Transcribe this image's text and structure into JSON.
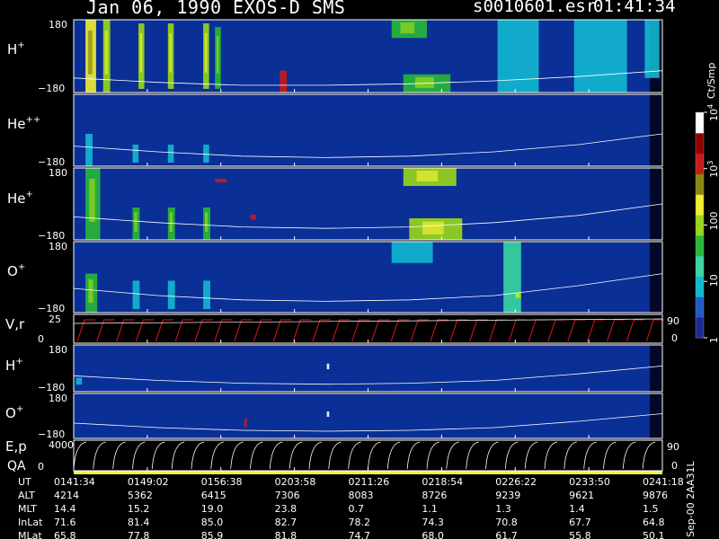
{
  "header": {
    "title": "Jan 06, 1990   EXOS-D SMS",
    "file": "s0010601.esr",
    "time": "01:41:34"
  },
  "colors": {
    "background": "#000000",
    "panel_fill": "#0a2f96",
    "axis": "#ffffff",
    "vr_trace": "#dd1a1a",
    "qa_bar": "#f0f050",
    "scale": [
      "#1c2a92",
      "#1e5ac8",
      "#12b8d0",
      "#38d8a0",
      "#28b838",
      "#98d818",
      "#f0f030",
      "#888810",
      "#c81a1a",
      "#900000",
      "#ffffff"
    ]
  },
  "colorbar": {
    "units": "Ct/Smp",
    "ticks": [
      {
        "label": "1",
        "value": 1
      },
      {
        "label": "10",
        "value": 10
      },
      {
        "label": "100",
        "value": 100
      },
      {
        "label": "10",
        "sup": "3",
        "value": 1000
      },
      {
        "label": "10",
        "sup": "4",
        "value": 10000
      }
    ]
  },
  "chart_data": {
    "type": "heatmap",
    "time_axis": [
      "0141:34",
      "0149:02",
      "0156:38",
      "0203:58",
      "0211:26",
      "0218:54",
      "0226:22",
      "0233:50",
      "0241:18"
    ],
    "panels": [
      {
        "id": "hplus-1",
        "label": "H",
        "sup": "+",
        "ylim": [
          -180,
          180
        ],
        "ticks": [
          "180",
          "−180"
        ],
        "blobs": [
          {
            "t": 0.02,
            "w": 0.018,
            "y0": 0.0,
            "y1": 1.0,
            "lvl": 6
          },
          {
            "t": 0.05,
            "w": 0.012,
            "y0": 0.0,
            "y1": 1.0,
            "lvl": 5
          },
          {
            "t": 0.11,
            "w": 0.01,
            "y0": 0.05,
            "y1": 0.95,
            "lvl": 5
          },
          {
            "t": 0.16,
            "w": 0.01,
            "y0": 0.05,
            "y1": 0.95,
            "lvl": 5
          },
          {
            "t": 0.22,
            "w": 0.01,
            "y0": 0.05,
            "y1": 0.95,
            "lvl": 5
          },
          {
            "t": 0.24,
            "w": 0.01,
            "y0": 0.1,
            "y1": 0.95,
            "lvl": 4
          },
          {
            "t": 0.35,
            "w": 0.012,
            "y0": 0.7,
            "y1": 1.0,
            "lvl": 8
          },
          {
            "t": 0.54,
            "w": 0.06,
            "y0": 0.0,
            "y1": 0.25,
            "lvl": 4
          },
          {
            "t": 0.56,
            "w": 0.08,
            "y0": 0.75,
            "y1": 1.0,
            "lvl": 4
          },
          {
            "t": 0.72,
            "w": 0.07,
            "y0": 0.0,
            "y1": 1.0,
            "lvl": 2
          },
          {
            "t": 0.85,
            "w": 0.09,
            "y0": 0.0,
            "y1": 1.0,
            "lvl": 2
          },
          {
            "t": 0.97,
            "w": 0.025,
            "y0": 0.0,
            "y1": 0.8,
            "lvl": 2
          }
        ],
        "curve": [
          0.8,
          0.86,
          0.9,
          0.9,
          0.88,
          0.84,
          0.78,
          0.7
        ]
      },
      {
        "id": "heplusplus",
        "label": "He",
        "sup": "++",
        "ylim": [
          -180,
          180
        ],
        "ticks": [
          "",
          "−180"
        ],
        "blobs": [
          {
            "t": 0.02,
            "w": 0.012,
            "y0": 0.55,
            "y1": 1.0,
            "lvl": 2
          },
          {
            "t": 0.1,
            "w": 0.01,
            "y0": 0.7,
            "y1": 0.95,
            "lvl": 2
          },
          {
            "t": 0.16,
            "w": 0.01,
            "y0": 0.7,
            "y1": 0.95,
            "lvl": 2
          },
          {
            "t": 0.22,
            "w": 0.01,
            "y0": 0.7,
            "y1": 0.95,
            "lvl": 2
          }
        ],
        "curve": [
          0.72,
          0.8,
          0.86,
          0.88,
          0.86,
          0.8,
          0.7,
          0.55
        ]
      },
      {
        "id": "heplus",
        "label": "He",
        "sup": "+",
        "ylim": [
          -180,
          180
        ],
        "ticks": [
          "180",
          "−180"
        ],
        "blobs": [
          {
            "t": 0.02,
            "w": 0.025,
            "y0": 0.0,
            "y1": 1.0,
            "lvl": 4
          },
          {
            "t": 0.1,
            "w": 0.012,
            "y0": 0.55,
            "y1": 1.0,
            "lvl": 4
          },
          {
            "t": 0.16,
            "w": 0.012,
            "y0": 0.55,
            "y1": 1.0,
            "lvl": 4
          },
          {
            "t": 0.22,
            "w": 0.012,
            "y0": 0.55,
            "y1": 1.0,
            "lvl": 4
          },
          {
            "t": 0.56,
            "w": 0.09,
            "y0": 0.0,
            "y1": 0.25,
            "lvl": 5
          },
          {
            "t": 0.57,
            "w": 0.09,
            "y0": 0.7,
            "y1": 1.0,
            "lvl": 5
          },
          {
            "t": 0.24,
            "w": 0.02,
            "y0": 0.15,
            "y1": 0.2,
            "lvl": 8
          },
          {
            "t": 0.3,
            "w": 0.01,
            "y0": 0.65,
            "y1": 0.72,
            "lvl": 8
          }
        ],
        "curve": [
          0.68,
          0.76,
          0.82,
          0.84,
          0.82,
          0.76,
          0.66,
          0.5
        ]
      },
      {
        "id": "oplus-1",
        "label": "O",
        "sup": "+",
        "ylim": [
          -180,
          180
        ],
        "ticks": [
          "180",
          "−180"
        ],
        "blobs": [
          {
            "t": 0.02,
            "w": 0.02,
            "y0": 0.45,
            "y1": 1.0,
            "lvl": 4
          },
          {
            "t": 0.1,
            "w": 0.012,
            "y0": 0.55,
            "y1": 0.95,
            "lvl": 2
          },
          {
            "t": 0.16,
            "w": 0.012,
            "y0": 0.55,
            "y1": 0.95,
            "lvl": 2
          },
          {
            "t": 0.22,
            "w": 0.012,
            "y0": 0.55,
            "y1": 0.95,
            "lvl": 2
          },
          {
            "t": 0.54,
            "w": 0.07,
            "y0": 0.0,
            "y1": 0.3,
            "lvl": 2
          },
          {
            "t": 0.73,
            "w": 0.03,
            "y0": 0.0,
            "y1": 1.0,
            "lvl": 3
          },
          {
            "t": 0.75,
            "w": 0.01,
            "y0": 0.72,
            "y1": 0.8,
            "lvl": 5
          }
        ],
        "curve": [
          0.66,
          0.76,
          0.82,
          0.84,
          0.82,
          0.76,
          0.62,
          0.45
        ]
      },
      {
        "id": "vr",
        "label": "V,r",
        "sup": "",
        "ylim": [
          0,
          25
        ],
        "ticks": [
          "25",
          "0"
        ],
        "right_tick": "90",
        "right_tick_bottom": "0"
      },
      {
        "id": "hplus-2",
        "label": "H",
        "sup": "+",
        "ylim": [
          -180,
          180
        ],
        "ticks": [
          "180",
          "−180"
        ],
        "blobs": [
          {
            "t": 0.004,
            "w": 0.01,
            "y0": 0.7,
            "y1": 0.85,
            "lvl": 2
          },
          {
            "t": 0.43,
            "w": 0.004,
            "y0": 0.4,
            "y1": 0.52,
            "lvl": 10
          }
        ],
        "curve": [
          0.66,
          0.76,
          0.82,
          0.84,
          0.82,
          0.76,
          0.62,
          0.45
        ]
      },
      {
        "id": "oplus-2",
        "label": "O",
        "sup": "+",
        "ylim": [
          -180,
          180
        ],
        "ticks": [
          "180",
          "−180"
        ],
        "blobs": [
          {
            "t": 0.29,
            "w": 0.004,
            "y0": 0.55,
            "y1": 0.75,
            "lvl": 8
          },
          {
            "t": 0.43,
            "w": 0.004,
            "y0": 0.4,
            "y1": 0.52,
            "lvl": 10
          }
        ],
        "curve": [
          0.66,
          0.76,
          0.82,
          0.84,
          0.82,
          0.76,
          0.62,
          0.45
        ]
      },
      {
        "id": "ep",
        "label": "E,p",
        "sup": "",
        "ylim": [
          0,
          4000
        ],
        "ticks": [
          "4000",
          "0"
        ],
        "right_tick": "90",
        "right_tick_bottom": "0"
      }
    ],
    "qa_label": "QA",
    "orbit_table": {
      "rows": [
        {
          "name": "UT",
          "values": [
            "0141:34",
            "0149:02",
            "0156:38",
            "0203:58",
            "0211:26",
            "0218:54",
            "0226:22",
            "0233:50",
            "0241:18"
          ]
        },
        {
          "name": "ALT",
          "values": [
            "4214",
            "5362",
            "6415",
            "7306",
            "8083",
            "8726",
            "9239",
            "9621",
            "9876"
          ]
        },
        {
          "name": "MLT",
          "values": [
            "14.4",
            "15.2",
            "19.0",
            "23.8",
            "0.7",
            "1.1",
            "1.3",
            "1.4",
            "1.5"
          ]
        },
        {
          "name": "InLat",
          "values": [
            "71.6",
            "81.4",
            "85.0",
            "82.7",
            "78.2",
            "74.3",
            "70.8",
            "67.7",
            "64.8"
          ]
        },
        {
          "name": "MLat",
          "values": [
            "65.8",
            "77.8",
            "85.9",
            "81.8",
            "74.7",
            "68.0",
            "61.7",
            "55.8",
            "50.1"
          ]
        }
      ]
    },
    "footer_vertical": "Sep-00  2AA31L"
  }
}
